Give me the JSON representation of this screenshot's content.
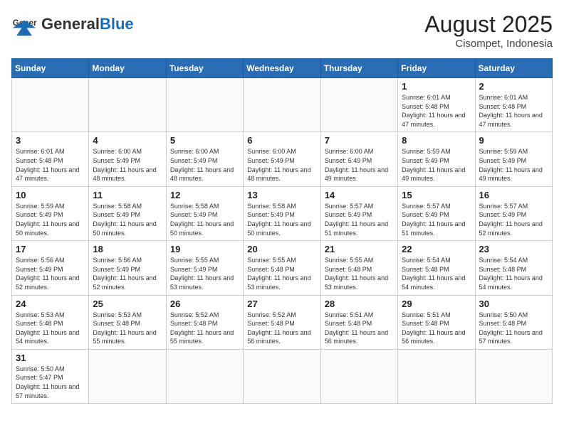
{
  "header": {
    "logo_general": "General",
    "logo_blue": "Blue",
    "month_year": "August 2025",
    "location": "Cisompet, Indonesia"
  },
  "days_of_week": [
    "Sunday",
    "Monday",
    "Tuesday",
    "Wednesday",
    "Thursday",
    "Friday",
    "Saturday"
  ],
  "weeks": [
    {
      "days": [
        {
          "date": "",
          "info": ""
        },
        {
          "date": "",
          "info": ""
        },
        {
          "date": "",
          "info": ""
        },
        {
          "date": "",
          "info": ""
        },
        {
          "date": "",
          "info": ""
        },
        {
          "date": "1",
          "info": "Sunrise: 6:01 AM\nSunset: 5:48 PM\nDaylight: 11 hours and 47 minutes."
        },
        {
          "date": "2",
          "info": "Sunrise: 6:01 AM\nSunset: 5:48 PM\nDaylight: 11 hours and 47 minutes."
        }
      ]
    },
    {
      "days": [
        {
          "date": "3",
          "info": "Sunrise: 6:01 AM\nSunset: 5:48 PM\nDaylight: 11 hours and 47 minutes."
        },
        {
          "date": "4",
          "info": "Sunrise: 6:00 AM\nSunset: 5:49 PM\nDaylight: 11 hours and 48 minutes."
        },
        {
          "date": "5",
          "info": "Sunrise: 6:00 AM\nSunset: 5:49 PM\nDaylight: 11 hours and 48 minutes."
        },
        {
          "date": "6",
          "info": "Sunrise: 6:00 AM\nSunset: 5:49 PM\nDaylight: 11 hours and 48 minutes."
        },
        {
          "date": "7",
          "info": "Sunrise: 6:00 AM\nSunset: 5:49 PM\nDaylight: 11 hours and 49 minutes."
        },
        {
          "date": "8",
          "info": "Sunrise: 5:59 AM\nSunset: 5:49 PM\nDaylight: 11 hours and 49 minutes."
        },
        {
          "date": "9",
          "info": "Sunrise: 5:59 AM\nSunset: 5:49 PM\nDaylight: 11 hours and 49 minutes."
        }
      ]
    },
    {
      "days": [
        {
          "date": "10",
          "info": "Sunrise: 5:59 AM\nSunset: 5:49 PM\nDaylight: 11 hours and 50 minutes."
        },
        {
          "date": "11",
          "info": "Sunrise: 5:58 AM\nSunset: 5:49 PM\nDaylight: 11 hours and 50 minutes."
        },
        {
          "date": "12",
          "info": "Sunrise: 5:58 AM\nSunset: 5:49 PM\nDaylight: 11 hours and 50 minutes."
        },
        {
          "date": "13",
          "info": "Sunrise: 5:58 AM\nSunset: 5:49 PM\nDaylight: 11 hours and 50 minutes."
        },
        {
          "date": "14",
          "info": "Sunrise: 5:57 AM\nSunset: 5:49 PM\nDaylight: 11 hours and 51 minutes."
        },
        {
          "date": "15",
          "info": "Sunrise: 5:57 AM\nSunset: 5:49 PM\nDaylight: 11 hours and 51 minutes."
        },
        {
          "date": "16",
          "info": "Sunrise: 5:57 AM\nSunset: 5:49 PM\nDaylight: 11 hours and 52 minutes."
        }
      ]
    },
    {
      "days": [
        {
          "date": "17",
          "info": "Sunrise: 5:56 AM\nSunset: 5:49 PM\nDaylight: 11 hours and 52 minutes."
        },
        {
          "date": "18",
          "info": "Sunrise: 5:56 AM\nSunset: 5:49 PM\nDaylight: 11 hours and 52 minutes."
        },
        {
          "date": "19",
          "info": "Sunrise: 5:55 AM\nSunset: 5:49 PM\nDaylight: 11 hours and 53 minutes."
        },
        {
          "date": "20",
          "info": "Sunrise: 5:55 AM\nSunset: 5:48 PM\nDaylight: 11 hours and 53 minutes."
        },
        {
          "date": "21",
          "info": "Sunrise: 5:55 AM\nSunset: 5:48 PM\nDaylight: 11 hours and 53 minutes."
        },
        {
          "date": "22",
          "info": "Sunrise: 5:54 AM\nSunset: 5:48 PM\nDaylight: 11 hours and 54 minutes."
        },
        {
          "date": "23",
          "info": "Sunrise: 5:54 AM\nSunset: 5:48 PM\nDaylight: 11 hours and 54 minutes."
        }
      ]
    },
    {
      "days": [
        {
          "date": "24",
          "info": "Sunrise: 5:53 AM\nSunset: 5:48 PM\nDaylight: 11 hours and 54 minutes."
        },
        {
          "date": "25",
          "info": "Sunrise: 5:53 AM\nSunset: 5:48 PM\nDaylight: 11 hours and 55 minutes."
        },
        {
          "date": "26",
          "info": "Sunrise: 5:52 AM\nSunset: 5:48 PM\nDaylight: 11 hours and 55 minutes."
        },
        {
          "date": "27",
          "info": "Sunrise: 5:52 AM\nSunset: 5:48 PM\nDaylight: 11 hours and 56 minutes."
        },
        {
          "date": "28",
          "info": "Sunrise: 5:51 AM\nSunset: 5:48 PM\nDaylight: 11 hours and 56 minutes."
        },
        {
          "date": "29",
          "info": "Sunrise: 5:51 AM\nSunset: 5:48 PM\nDaylight: 11 hours and 56 minutes."
        },
        {
          "date": "30",
          "info": "Sunrise: 5:50 AM\nSunset: 5:48 PM\nDaylight: 11 hours and 57 minutes."
        }
      ]
    },
    {
      "days": [
        {
          "date": "31",
          "info": "Sunrise: 5:50 AM\nSunset: 5:47 PM\nDaylight: 11 hours and 57 minutes."
        },
        {
          "date": "",
          "info": ""
        },
        {
          "date": "",
          "info": ""
        },
        {
          "date": "",
          "info": ""
        },
        {
          "date": "",
          "info": ""
        },
        {
          "date": "",
          "info": ""
        },
        {
          "date": "",
          "info": ""
        }
      ]
    }
  ]
}
